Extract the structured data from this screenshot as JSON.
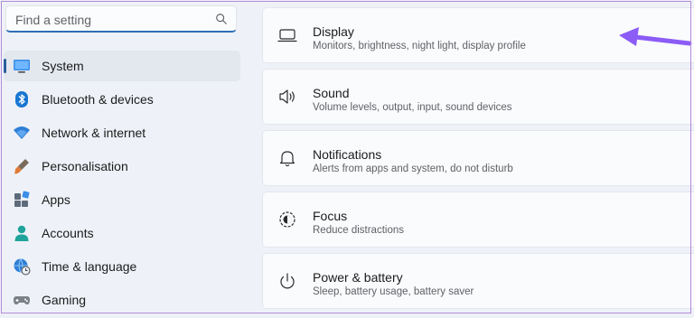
{
  "search": {
    "placeholder": "Find a setting",
    "icon": "search-icon"
  },
  "sidebar": {
    "items": [
      {
        "label": "System",
        "icon": "system-icon",
        "selected": true
      },
      {
        "label": "Bluetooth & devices",
        "icon": "bluetooth-icon"
      },
      {
        "label": "Network & internet",
        "icon": "wifi-icon"
      },
      {
        "label": "Personalisation",
        "icon": "brush-icon"
      },
      {
        "label": "Apps",
        "icon": "apps-icon"
      },
      {
        "label": "Accounts",
        "icon": "account-icon"
      },
      {
        "label": "Time & language",
        "icon": "globe-clock-icon"
      },
      {
        "label": "Gaming",
        "icon": "gamepad-icon"
      }
    ]
  },
  "main": {
    "cards": [
      {
        "title": "Display",
        "subtitle": "Monitors, brightness, night light, display profile",
        "icon": "monitor-icon"
      },
      {
        "title": "Sound",
        "subtitle": "Volume levels, output, input, sound devices",
        "icon": "speaker-icon"
      },
      {
        "title": "Notifications",
        "subtitle": "Alerts from apps and system, do not disturb",
        "icon": "bell-icon"
      },
      {
        "title": "Focus",
        "subtitle": "Reduce distractions",
        "icon": "focus-icon"
      },
      {
        "title": "Power & battery",
        "subtitle": "Sleep, battery usage, battery saver",
        "icon": "power-icon"
      }
    ]
  },
  "annotation": {
    "arrow_color": "#8b5cf6"
  }
}
